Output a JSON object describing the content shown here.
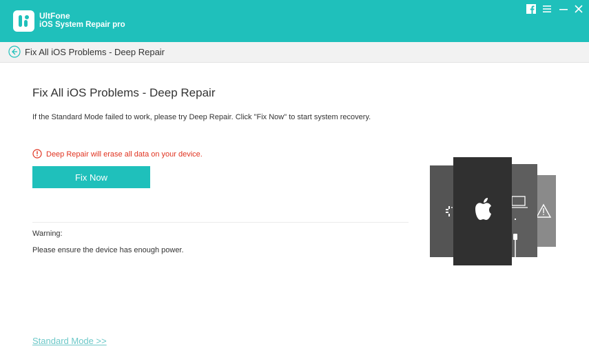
{
  "app": {
    "name": "UltFone",
    "subtitle": "iOS System Repair pro"
  },
  "window_controls": [
    {
      "icon": "facebook-icon"
    },
    {
      "icon": "menu-icon"
    },
    {
      "icon": "minimize-icon"
    },
    {
      "icon": "close-icon"
    }
  ],
  "breadcrumb": {
    "back_icon": "back-arrow-icon",
    "text": "Fix All iOS Problems - Deep Repair"
  },
  "main": {
    "title": "Fix All iOS Problems - Deep Repair",
    "description": "If the Standard Mode failed to work, please try Deep Repair. Click \"Fix Now\" to start system recovery.",
    "alert": "Deep Repair will erase all data on your device.",
    "fix_button": "Fix Now",
    "warning_label": "Warning:",
    "warning_text": "Please ensure the device has enough power.",
    "standard_mode_link": "Standard Mode >>"
  },
  "colors": {
    "accent": "#1fc0bb",
    "alert": "#e0321f",
    "link": "#6cc8c8"
  }
}
